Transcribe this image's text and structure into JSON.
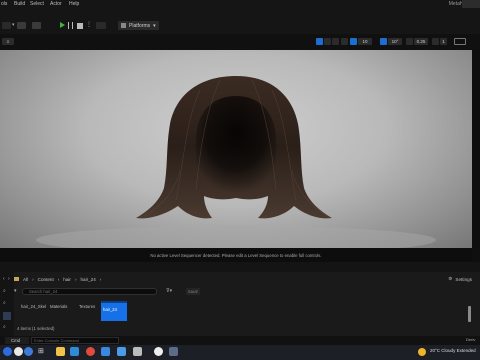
{
  "menubar": {
    "items": [
      "ols",
      "Build",
      "Select",
      "Actor",
      "Help"
    ],
    "app_title": "MetaHuman"
  },
  "toolbar": {
    "platforms_label": "Platforms"
  },
  "viewport": {
    "toolbar_values": [
      "10",
      "10°",
      "0.25",
      "1"
    ],
    "status_message": "No active Level Sequencer detected. Please edit a Level Sequence to enable full controls."
  },
  "content_browser": {
    "path": [
      "All",
      "Content",
      "hair",
      "hair_24"
    ],
    "settings_label": "Settings",
    "search_placeholder": "Search hair_24",
    "save_label": "SAVE",
    "folders": [
      "hair_24_Skel",
      "Materials",
      "Textures"
    ],
    "selected_item": "hair_24",
    "item_count": "4 items (1 selected)"
  },
  "cmd": {
    "dropdown_label": "Cmd",
    "placeholder": "Enter Console Command"
  },
  "taskbar": {
    "weather": "20°C Cloudy",
    "weather_label": "Extended"
  },
  "side_panel_label": "Deriv"
}
